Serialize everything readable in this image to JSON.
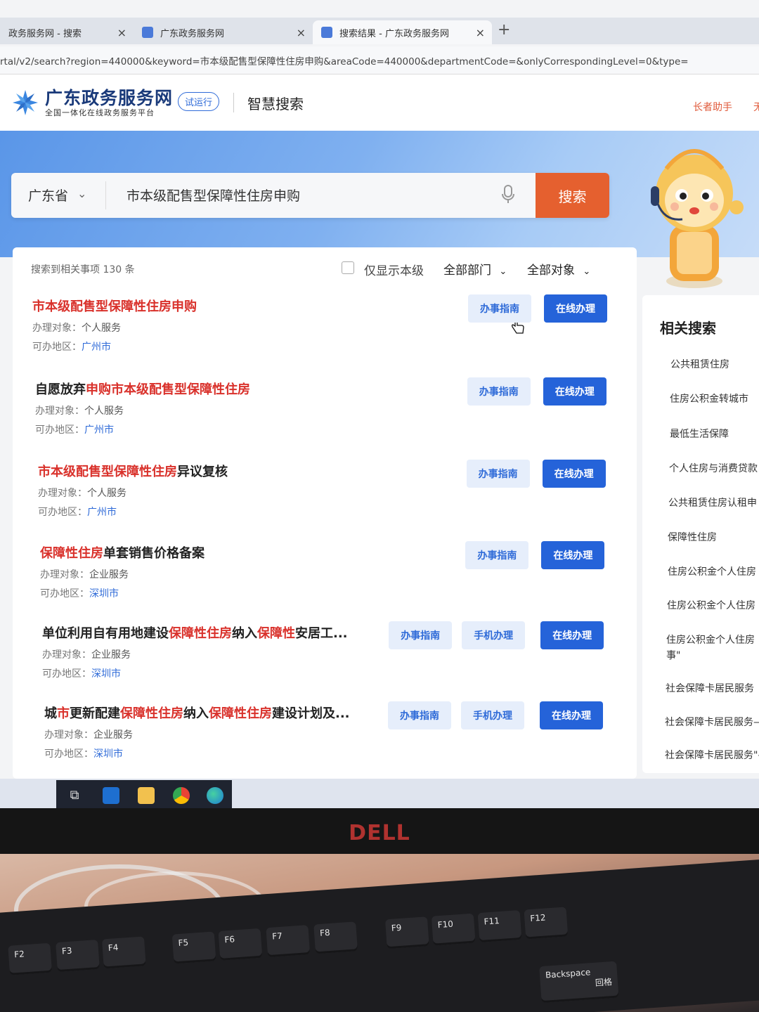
{
  "browser": {
    "tabs": [
      {
        "label": "政务服务网 - 搜索"
      },
      {
        "label": "广东政务服务网"
      },
      {
        "label": "搜索结果 - 广东政务服务网"
      }
    ],
    "new_tab": "+",
    "close_glyph": "×",
    "url": "rtal/v2/search?region=440000&keyword=市本级配售型保障性住房申购&areaCode=440000&departmentCode=&onlyCorrespondingLevel=0&type="
  },
  "header": {
    "site_name": "广东政务服务网",
    "site_subtitle": "全国一体化在线政务服务平台",
    "trial_badge": "试运行",
    "page_title": "智慧搜索",
    "elder_helper": "长者助手",
    "extra": "无"
  },
  "search": {
    "region": "广东省",
    "keyword": "市本级配售型保障性住房申购",
    "button": "搜索"
  },
  "filters": {
    "result_count": "搜索到相关事项 130 条",
    "only_level_label": "仅显示本级",
    "department": "全部部门",
    "target": "全部对象"
  },
  "results": [
    {
      "title_parts": [
        {
          "t": "市本级配售型保障性住房申购",
          "hl": true
        }
      ],
      "target_label": "办理对象：",
      "target": "个人服务",
      "area_label": "可办地区：",
      "area": "广州市",
      "guide": "办事指南",
      "online": "在线办理"
    },
    {
      "title_parts": [
        {
          "t": "自愿放弃",
          "hl": false
        },
        {
          "t": "申购市本级配售型保障性住房",
          "hl": true
        }
      ],
      "target_label": "办理对象：",
      "target": "个人服务",
      "area_label": "可办地区：",
      "area": "广州市",
      "guide": "办事指南",
      "online": "在线办理"
    },
    {
      "title_parts": [
        {
          "t": "市本级配售型保障性住房",
          "hl": true
        },
        {
          "t": "异议复核",
          "hl": false
        }
      ],
      "target_label": "办理对象：",
      "target": "个人服务",
      "area_label": "可办地区：",
      "area": "广州市",
      "guide": "办事指南",
      "online": "在线办理"
    },
    {
      "title_parts": [
        {
          "t": "保障性住房",
          "hl": true
        },
        {
          "t": "单套销售价格备案",
          "hl": false
        }
      ],
      "target_label": "办理对象：",
      "target": "企业服务",
      "area_label": "可办地区：",
      "area": "深圳市",
      "guide": "办事指南",
      "online": "在线办理"
    },
    {
      "title_parts": [
        {
          "t": "单位利用自有用地建设",
          "hl": false
        },
        {
          "t": "保障性住房",
          "hl": true
        },
        {
          "t": "纳入",
          "hl": false
        },
        {
          "t": "保障性",
          "hl": true
        },
        {
          "t": "安居工...",
          "hl": false
        }
      ],
      "target_label": "办理对象：",
      "target": "企业服务",
      "area_label": "可办地区：",
      "area": "深圳市",
      "guide": "办事指南",
      "mobile": "手机办理",
      "online": "在线办理"
    },
    {
      "title_parts": [
        {
          "t": "城",
          "hl": false
        },
        {
          "t": "市",
          "hl": true
        },
        {
          "t": "更新配建",
          "hl": false
        },
        {
          "t": "保障性住房",
          "hl": true
        },
        {
          "t": "纳入",
          "hl": false
        },
        {
          "t": "保障性住房",
          "hl": true
        },
        {
          "t": "建设计划及...",
          "hl": false
        }
      ],
      "target_label": "办理对象：",
      "target": "企业服务",
      "area_label": "可办地区：",
      "area": "深圳市",
      "guide": "办事指南",
      "mobile": "手机办理",
      "online": "在线办理"
    }
  ],
  "related": {
    "title": "相关搜索",
    "items": [
      "公共租赁住房",
      "住房公积金转城市",
      "最低生活保障",
      "个人住房与消费贷款",
      "公共租赁住房认租申",
      "保障性住房",
      "住房公积金个人住房",
      "住房公积金个人住房",
      "住房公积金个人住房",
      "事\"",
      "社会保障卡居民服务",
      "社会保障卡居民服务—",
      "社会保障卡居民服务\"-"
    ]
  },
  "monitor": {
    "brand": "DELL"
  },
  "keyboard": {
    "keys": [
      "F2",
      "F3",
      "F4",
      "F5",
      "F6",
      "F7",
      "F8",
      "F9",
      "F10",
      "F11",
      "F12",
      "Backspace",
      "回格"
    ]
  }
}
